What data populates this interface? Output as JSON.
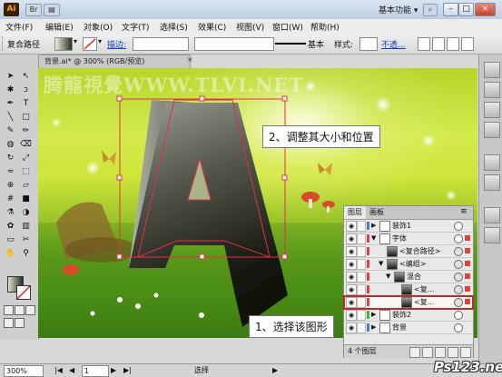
{
  "titlebar": {
    "logo": "Ai",
    "workspace": "基本功能",
    "minimize": "–",
    "maximize": "□",
    "close": "×"
  },
  "menu": [
    "文件(F)",
    "编辑(E)",
    "对象(O)",
    "文字(T)",
    "选择(S)",
    "效果(C)",
    "视图(V)",
    "窗口(W)",
    "帮助(H)"
  ],
  "control": {
    "object_type": "复合路径",
    "stroke_label": "描边:",
    "stroke_style": "基本",
    "style_label": "样式:",
    "opacity_link": "不透..."
  },
  "document": {
    "tab_title": "背景.ai* @ 300% (RGB/预览)",
    "close": "×",
    "watermark": "腾龍視覺WWW.TLVI.NET"
  },
  "artwork": {
    "letter": "A",
    "fill_top": "#8c8f86",
    "fill_bottom": "#1a1c14",
    "selection_color": "#e0304a"
  },
  "callouts": {
    "top": "2、调整其大小和位置",
    "bottom": "1、选择该图形"
  },
  "layers_panel": {
    "tabs": [
      "图层",
      "画板"
    ],
    "rows": [
      {
        "name": "装饰1",
        "indent": 0,
        "expand": "▶",
        "color": "#4a7bd8",
        "eye": true
      },
      {
        "name": "字体",
        "indent": 0,
        "expand": "▼",
        "color": "#e04040",
        "eye": true
      },
      {
        "name": "<复合路径>",
        "indent": 1,
        "expand": "",
        "color": "#e04040",
        "eye": true
      },
      {
        "name": "<编组>",
        "indent": 1,
        "expand": "▼",
        "color": "#e04040",
        "eye": true
      },
      {
        "name": "混合",
        "indent": 2,
        "expand": "▼",
        "color": "#e04040",
        "eye": true
      },
      {
        "name": "<复...",
        "indent": 3,
        "expand": "",
        "color": "#e04040",
        "eye": true
      },
      {
        "name": "<复...",
        "indent": 3,
        "expand": "",
        "color": "#e04040",
        "eye": true
      },
      {
        "name": "装饰2",
        "indent": 0,
        "expand": "▶",
        "color": "#3cb83c",
        "eye": true
      },
      {
        "name": "背景",
        "indent": 0,
        "expand": "▶",
        "color": "#4a7bd8",
        "eye": true
      }
    ],
    "layer_count": "4 个图层",
    "highlight_color": "#c0282c"
  },
  "status": {
    "zoom": "300%",
    "page": "1",
    "tool": "选择"
  },
  "branding": {
    "site": "Ps123.net"
  }
}
